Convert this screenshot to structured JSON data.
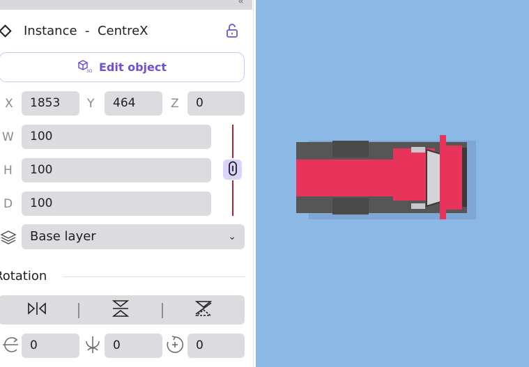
{
  "instance": {
    "kind": "Instance",
    "separator": "-",
    "name": "CentreX"
  },
  "edit_button": {
    "label": "Edit object"
  },
  "position": {
    "x_label": "X",
    "x": "1853",
    "y_label": "Y",
    "y": "464",
    "z_label": "Z",
    "z": "0"
  },
  "size": {
    "w_label": "W",
    "w": "100",
    "h_label": "H",
    "h": "100",
    "d_label": "D",
    "d": "100"
  },
  "layer": {
    "selected": "Base layer"
  },
  "rotation": {
    "title": "Rotation",
    "x": "0",
    "y": "0",
    "z": "0"
  },
  "colors": {
    "accent": "#6e4fd6",
    "canvas": "#8cb8e6",
    "vehicle_body": "#e8335a",
    "vehicle_frame": "#555555"
  }
}
